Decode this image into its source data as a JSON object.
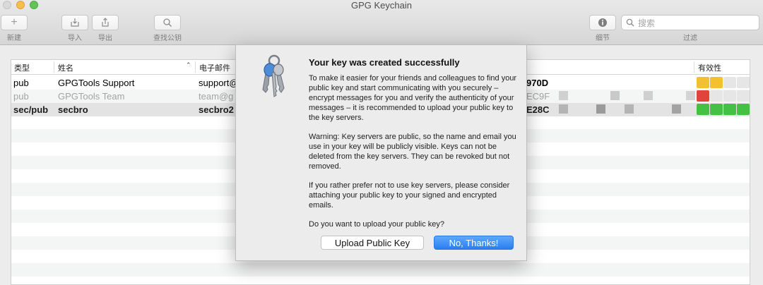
{
  "window": {
    "title": "GPG Keychain"
  },
  "toolbar": {
    "new_label": "新建",
    "import_label": "导入",
    "export_label": "导出",
    "lookup_label": "查找公钥",
    "details_label": "细节",
    "filter_label": "过滤",
    "search_placeholder": "搜索"
  },
  "table": {
    "columns": [
      "类型",
      "姓名",
      "电子邮件",
      "有效性"
    ],
    "rows": [
      {
        "type": "pub",
        "name": "GPGTools Support",
        "email": "support@",
        "key_id": "970D",
        "validity_color": "#f3c02f"
      },
      {
        "type": "pub",
        "name": "GPGTools Team",
        "email": "team@g",
        "key_id": "EC9F",
        "validity_color": "#e0443a"
      },
      {
        "type": "sec/pub",
        "name": "secbro",
        "email": "secbro2",
        "key_id": "E28C",
        "validity_color": "#44c144"
      }
    ]
  },
  "dialog": {
    "title": "Your key was created successfully",
    "para1": "To make it easier for your friends and colleagues to find your public key and start communicating with you securely – encrypt messages for you and verify the authenticity of your messages – it is recommended to upload your public key to the key servers.",
    "para2": "Warning: Key servers are public, so the name and email you use in your key will be publicly visible. Keys can not be deleted from the key servers. They can be revoked but not removed.",
    "para3": "If you rather prefer not to use key servers, please consider attaching your public key to your signed and encrypted emails.",
    "question": "Do you want to upload your public key?",
    "upload_button": "Upload Public Key",
    "decline_button": "No, Thanks!"
  },
  "colors": {
    "accent": "#2a7ef0",
    "selection": "#e3e3e3"
  }
}
